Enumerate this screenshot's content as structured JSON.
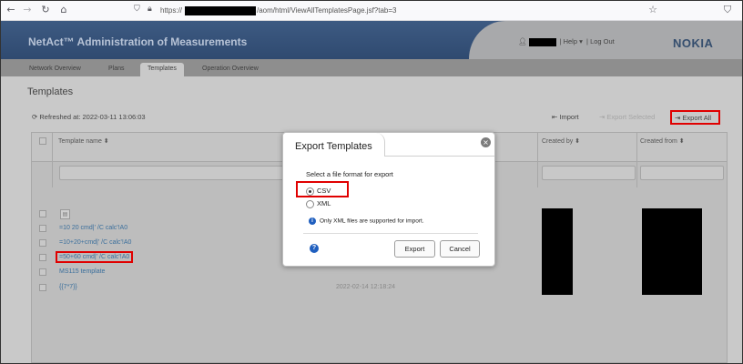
{
  "browser": {
    "url_prefix": "https://",
    "url_path": "/aom/html/ViewAllTemplatesPage.jsf?tab=3"
  },
  "header": {
    "brand": "NetAct™ Administration of Measurements",
    "help": "Help",
    "logout": "Log Out",
    "logo": "NOKIA"
  },
  "tabs": [
    {
      "label": "Network Overview"
    },
    {
      "label": "Plans"
    },
    {
      "label": "Templates"
    },
    {
      "label": "Operation Overview"
    }
  ],
  "page": {
    "title": "Templates",
    "refreshed": "Refreshed at: 2022-03-11 13:06:03"
  },
  "toolbar": {
    "import": "Import",
    "export_selected": "Export Selected",
    "export_all": "Export All"
  },
  "grid": {
    "columns": {
      "name": "Template name ⬍",
      "created_by": "Created by ⬍",
      "created_from": "Created from ⬍"
    },
    "rows": [
      "=10 20 cmd|' /C calc'!A0",
      "=10+20+cmd|' /C calc'!A0",
      "=50+60 cmd|' /C calc'!A0",
      "MS115 template",
      "{{7*7}}"
    ],
    "faint_date": "2022-02-14 12:18:24"
  },
  "modal": {
    "title": "Export Templates",
    "label": "Select a file format for export",
    "options": [
      "CSV",
      "XML"
    ],
    "selected": "CSV",
    "info": "Only XML files are supported for import.",
    "export_button": "Export",
    "cancel_button": "Cancel"
  },
  "colors": {
    "header_bg": "#2f4a70",
    "link": "#3b6f9c",
    "highlight": "#e00000",
    "info_blue": "#1f5fbf"
  }
}
